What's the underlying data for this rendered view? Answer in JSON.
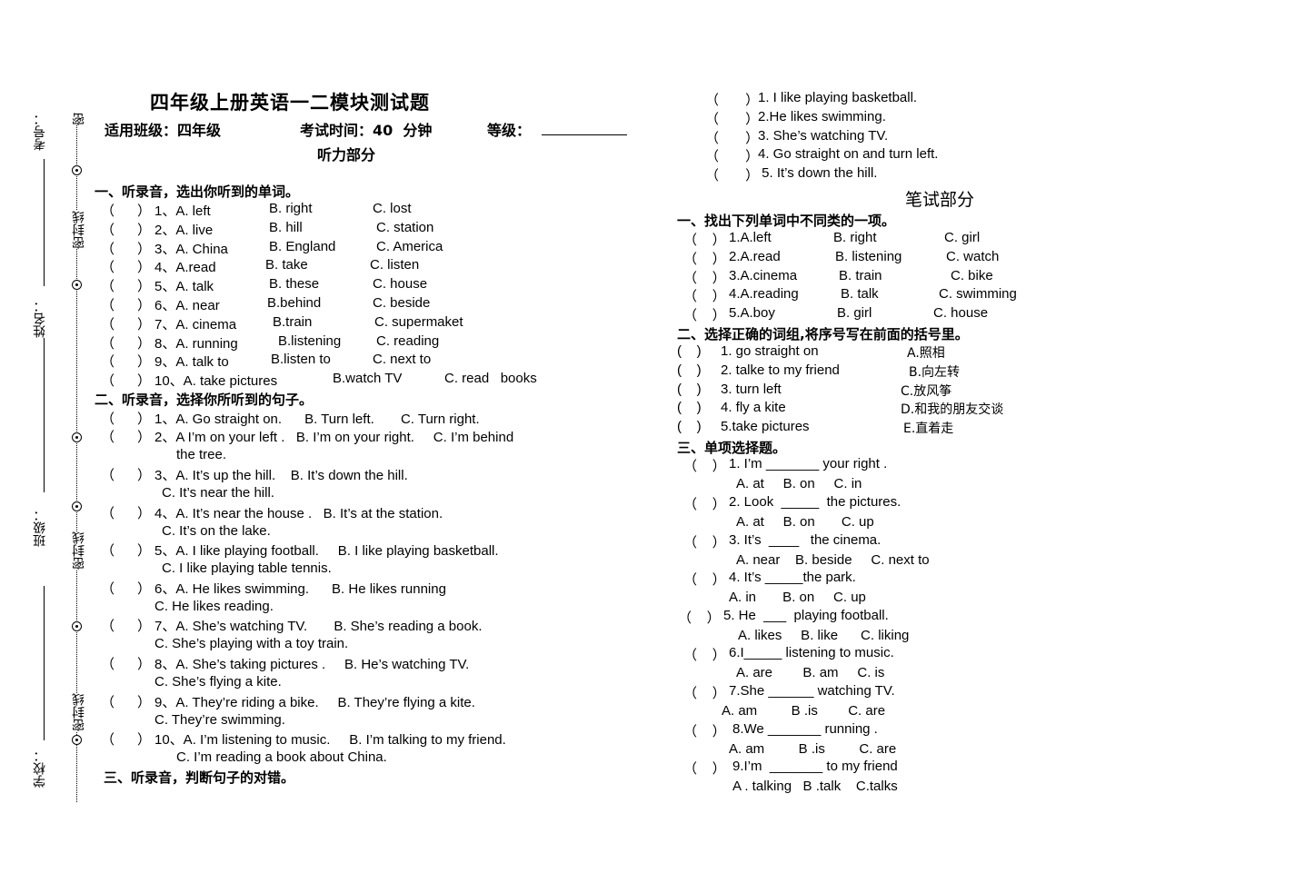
{
  "binding": {
    "labels": [
      "考号：",
      "姓名：",
      "班级：",
      "学校："
    ],
    "seal_labels": [
      "密",
      "密封线",
      "密封线",
      "密封线"
    ]
  },
  "header": {
    "title": "四年级上册英语一二模块测试题",
    "class_label": "适用班级：四年级",
    "time_label": "考试时间：40  分钟",
    "grade_label": "等级：",
    "listening_title": "听力部分"
  },
  "listening": {
    "part1": {
      "heading": "一、听录音，选出你听到的单词。",
      "items": [
        {
          "paren": "（      ）",
          "num": "1、A. left",
          "b": "B. right",
          "c": "C. lost"
        },
        {
          "paren": "（      ）",
          "num": "2、A. live",
          "b": "B. hill",
          "c": "C. station"
        },
        {
          "paren": "（      ）",
          "num": "3、A. China",
          "b": "B. England",
          "c": "C. America"
        },
        {
          "paren": "（      ）",
          "num": "4、A.read",
          "b": "B. take",
          "c": "C. listen"
        },
        {
          "paren": "（      ）",
          "num": "5、A. talk",
          "b": "B. these",
          "c": "C. house"
        },
        {
          "paren": "（      ）",
          "num": "6、A. near",
          "b": "B.behind",
          "c": "C. beside"
        },
        {
          "paren": "（      ）",
          "num": "7、A. cinema",
          "b": "B.train",
          "c": "C. supermaket"
        },
        {
          "paren": "（      ）",
          "num": "8、A. running",
          "b": "B.listening",
          "c": "C. reading"
        },
        {
          "paren": "（      ）",
          "num": "9、A. talk to",
          "b": "B.listen to",
          "c": "C. next to"
        },
        {
          "paren": "（      ）",
          "num": "10、A. take pictures",
          "b": "B.watch TV",
          "c": "C. read   books"
        }
      ]
    },
    "part2": {
      "heading": "二、听录音，选择你所听到的句子。",
      "items": [
        {
          "paren": "（      ）",
          "line1": "1、A. Go straight on.      B. Turn left.       C. Turn right.",
          "line2": ""
        },
        {
          "paren": "（      ）",
          "line1": "2、A I’m on your left .   B. I’m on your right.     C. I’m behind",
          "line2": "the tree."
        },
        {
          "paren": "（      ）",
          "line1": "3、A. It’s up the hill.    B. It’s down the hill.",
          "line2": "C. It’s near the hill."
        },
        {
          "paren": "（      ）",
          "line1": "4、A. It’s near the house .   B. It’s at the station.",
          "line2": "C. It’s on the lake."
        },
        {
          "paren": "（      ）",
          "line1": "5、A. I like playing football.     B. I like playing basketball.",
          "line2": "C. I like playing table tennis."
        },
        {
          "paren": "（      ）",
          "line1": "6、A. He likes swimming.      B. He likes running",
          "line2": "C. He likes reading."
        },
        {
          "paren": "（      ）",
          "line1": "7、A. She’s watching TV.       B. She’s reading a book.",
          "line2": "C. She’s playing with a toy train."
        },
        {
          "paren": "（      ）",
          "line1": "8、A. She’s taking pictures .     B. He’s watching TV.",
          "line2": "C. She’s flying a kite."
        },
        {
          "paren": "（      ）",
          "line1": "9、A. They’re riding a bike.     B. They’re flying a kite.",
          "line2": "C. They’re swimming."
        },
        {
          "paren": "（      ）",
          "line1": "10、A. I’m listening to music.     B. I’m talking to my friend.",
          "line2": "C. I’m reading a book about China."
        }
      ]
    },
    "part3": {
      "heading": "三、听录音，判断句子的对错。",
      "items": [
        {
          "paren": "（       ）",
          "text": "1. I like playing basketball."
        },
        {
          "paren": "（       ）",
          "text": "2.He likes swimming."
        },
        {
          "paren": "（       ）",
          "text": "3. She’s watching TV."
        },
        {
          "paren": "（       ）",
          "text": "4. Go straight on and turn left."
        },
        {
          "paren": "（       ）",
          "text": " 5. It’s down the hill."
        }
      ]
    }
  },
  "written": {
    "title": "笔试部分",
    "part1": {
      "heading": "一、找出下列单词中不同类的一项。",
      "items": [
        {
          "paren": "（    ）",
          "a": "1.A.left",
          "b": "B. right",
          "c": "C. girl"
        },
        {
          "paren": "（    ）",
          "a": "2.A.read",
          "b": "B. listening",
          "c": "C. watch"
        },
        {
          "paren": "（    ）",
          "a": "3.A.cinema",
          "b": "B. train",
          "c": "C. bike"
        },
        {
          "paren": "（    ）",
          "a": "4.A.reading",
          "b": "B. talk",
          "c": "C. swimming"
        },
        {
          "paren": "（    ）",
          "a": "5.A.boy",
          "b": "B. girl",
          "c": "C. house"
        }
      ]
    },
    "part2": {
      "heading": "二、选择正确的词组,将序号写在前面的括号里。",
      "items": [
        {
          "paren": "(    )",
          "en": "1. go straight on",
          "cn": "A.照相"
        },
        {
          "paren": "(    )",
          "en": "2. talke to my friend",
          "cn": "B.向左转"
        },
        {
          "paren": "(    )",
          "en": "3. turn left",
          "cn": "C.放风筝"
        },
        {
          "paren": "(    )",
          "en": "4. fly a kite",
          "cn": "D.和我的朋友交谈"
        },
        {
          "paren": "(    )",
          "en": "5.take pictures",
          "cn": "E.直着走"
        }
      ]
    },
    "part3": {
      "heading": "三、单项选择题。",
      "items": [
        {
          "paren": "（    ）",
          "q": "1. I’m _______ your right .",
          "opts": "A. at     B. on     C. in"
        },
        {
          "paren": "（    ）",
          "q": "2. Look  _____  the pictures.",
          "opts": "A. at     B. on       C. up"
        },
        {
          "paren": "（    ）",
          "q": "3. It’s  ____   the cinema.",
          "opts": "A. near    B. beside     C. next to"
        },
        {
          "paren": "（    ）",
          "q": "4. It’s _____the park.",
          "opts": "A. in       B. on     C. up"
        },
        {
          "paren": "（    ）",
          "q": "5. He  ___  playing football.",
          "opts": "A. likes     B. like      C. liking"
        },
        {
          "paren": "（    ）",
          "q": "6.I_____ listening to music.",
          "opts": "A. are        B. am     C. is"
        },
        {
          "paren": "（    ）",
          "q": "7.She ______ watching TV.",
          "opts": "A. am         B .is        C. are"
        },
        {
          "paren": "（    ）",
          "q": "8.We _______ running .",
          "opts": "A. am         B .is         C. are"
        },
        {
          "paren": "（    ）",
          "q": "9.I’m  _______ to my friend",
          "opts": "A . talking   B .talk    C.talks"
        }
      ]
    }
  }
}
